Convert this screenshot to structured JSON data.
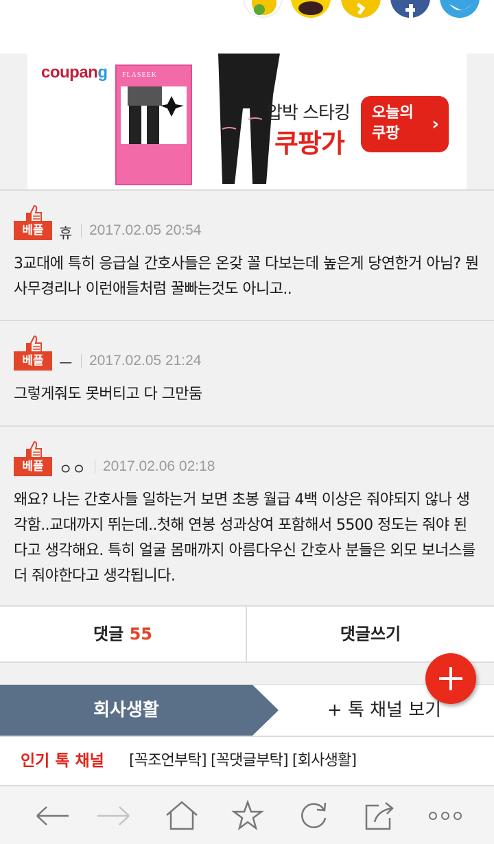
{
  "share": {
    "items": [
      {
        "name": "kakaostory",
        "color": "#f5c400"
      },
      {
        "name": "kakaotalk",
        "color": "#f7d200"
      },
      {
        "name": "kakao-channel",
        "color": "#f5c400"
      },
      {
        "name": "facebook",
        "color": "#3b5b98"
      },
      {
        "name": "twitter",
        "color": "#3aa4e0"
      }
    ]
  },
  "ad": {
    "logo_main": "coupan",
    "logo_g": "g",
    "product_brand": "FLASEEK",
    "copy_line1": "압박 스타킹",
    "copy_line2": "쿠팡가",
    "cta_line1": "오늘의",
    "cta_line2": "쿠팡",
    "cta_chevron": "›",
    "info_label": "!"
  },
  "comments": [
    {
      "badge": "베플",
      "author": "휴",
      "time": "2017.02.05 20:54",
      "body": "3교대에 특히 응급실 간호사들은 온갖 꼴 다보는데 높은게 당연한거 아님? 뭔 사무경리나 이런애들처럼 꿀빠는것도 아니고.."
    },
    {
      "badge": "베플",
      "author": "ㅡ",
      "time": "2017.02.05 21:24",
      "body": "그렇게줘도 못버티고 다 그만둠"
    },
    {
      "badge": "베플",
      "author": "ㅇㅇ",
      "time": "2017.02.06 02:18",
      "body": "왜요? 나는 간호사들 일하는거 보면 초봉 월급 4백 이상은 줘야되지 않나 생각함..교대까지 뛰는데..첫해 연봉 성과상여 포함해서 5500 정도는 줘야 된다고 생각해요. 특히 얼굴 몸매까지 아름다우신 간호사 분들은 외모 보너스를 더 줘야한다고 생각됩니다."
    }
  ],
  "actions": {
    "comments_label": "댓글",
    "comments_count": "55",
    "write_label": "댓글쓰기"
  },
  "channel": {
    "current": "회사생활",
    "more": "+ 톡 채널 보기"
  },
  "popular": {
    "title": "인기 톡 채널",
    "links": "[꼭조언부탁] [꼭댓글부탁] [회사생활]"
  },
  "browser": {
    "buttons": [
      "back-icon",
      "forward-icon",
      "home-icon",
      "bookmark-star-icon",
      "refresh-icon",
      "share-icon",
      "more-icon"
    ]
  },
  "colors": {
    "accent": "#e2452a",
    "channel_tab": "#5a7088",
    "fab": "#ea2a1b"
  }
}
